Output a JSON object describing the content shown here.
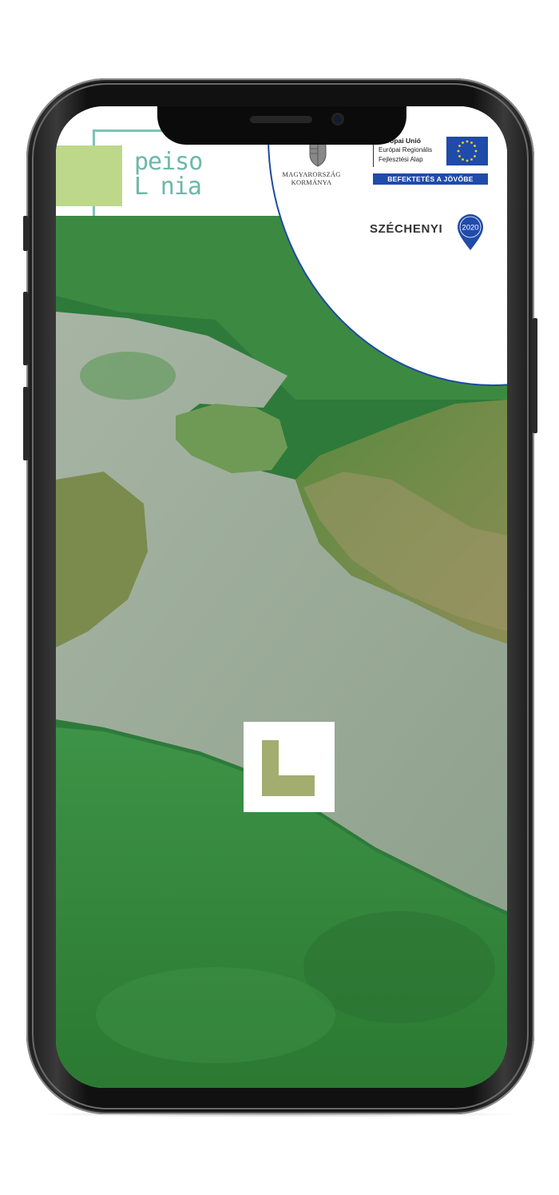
{
  "device": "iPhone",
  "header": {
    "logo": {
      "line1": "peiso",
      "line2": "ᒪ nia"
    },
    "menu_icon": "hamburger-menu-icon",
    "accent_color": "#6cb8a9",
    "logo_square_color": "#bdd88a"
  },
  "funding_badge": {
    "government": {
      "line1": "MAGYARORSZÁG",
      "line2": "KORMÁNYA",
      "icon": "hungarian-coat-of-arms-icon"
    },
    "eu": {
      "title": "Európai Unió",
      "fund_line1": "Európai Regionális",
      "fund_line2": "Fejlesztési Alap",
      "banner": "BEFEKTETÉS A JÖVŐBE",
      "flag_icon": "eu-flag-icon",
      "color": "#1f4ba9"
    },
    "program": {
      "name": "SZÉCHENYI",
      "year": "2020",
      "icon": "location-pin-icon"
    }
  },
  "hero": {
    "image": "aerial-wetland-lake-photo",
    "center_logo_icon": "peisonia-l-mark-icon"
  }
}
